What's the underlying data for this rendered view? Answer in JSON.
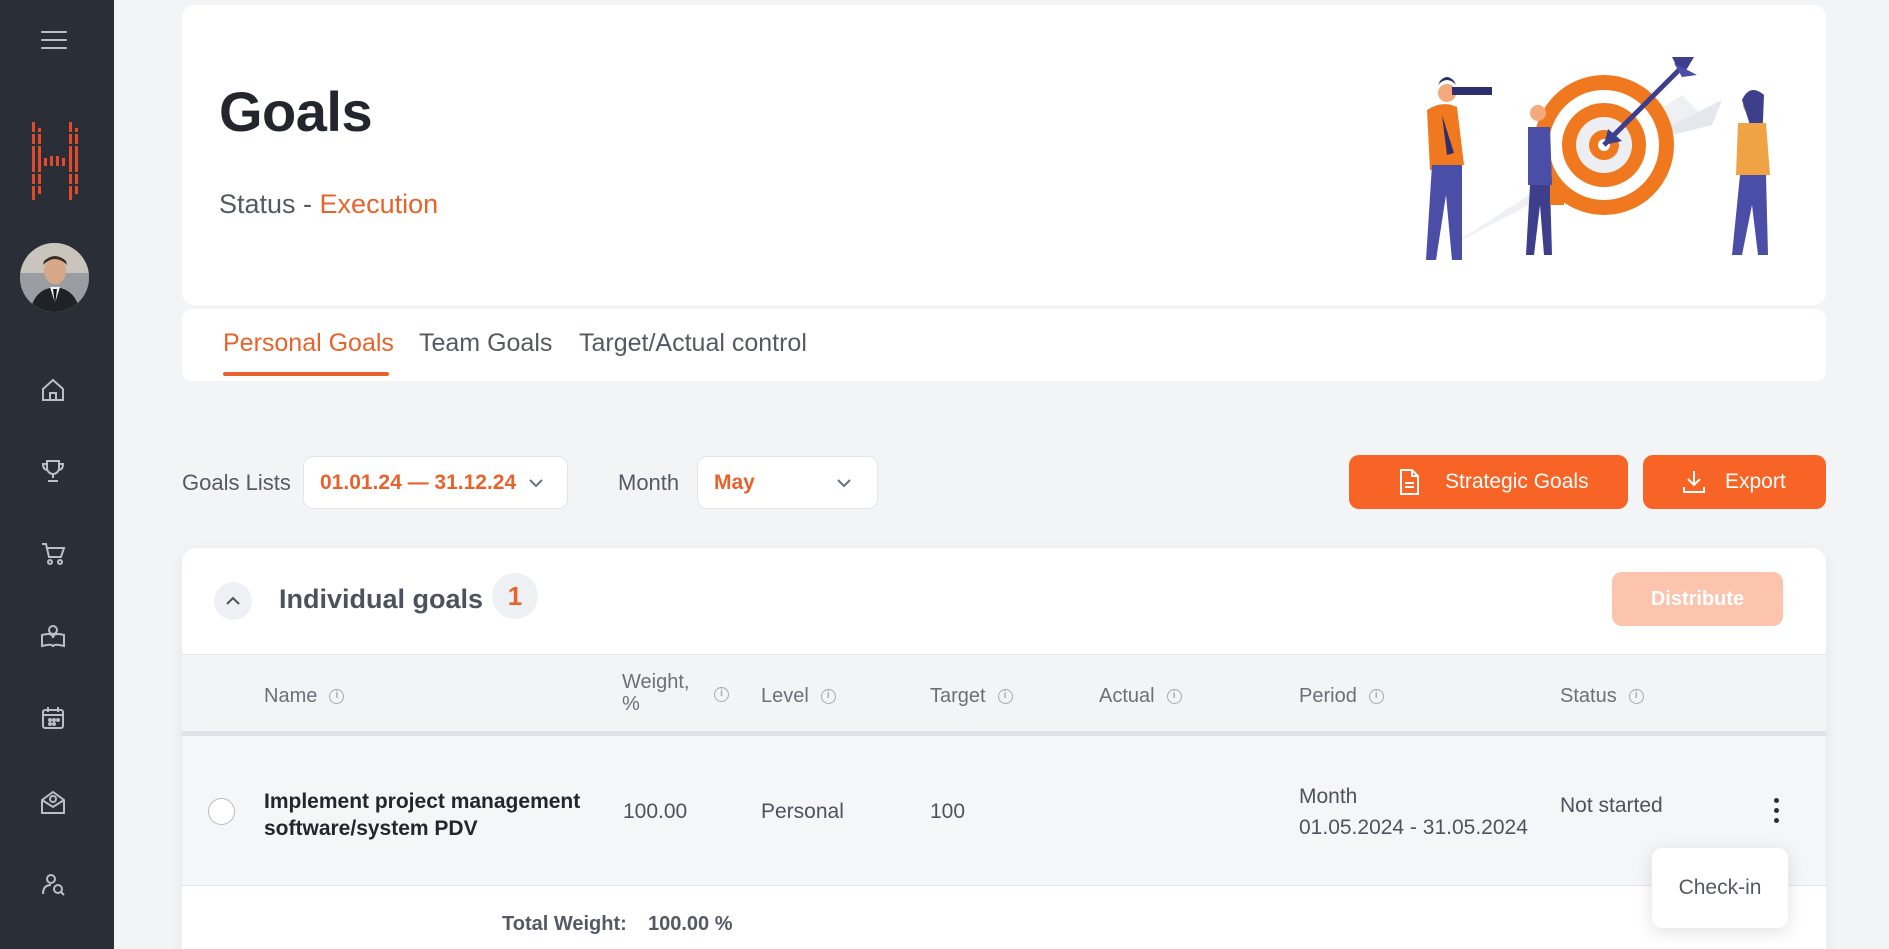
{
  "header": {
    "title": "Goals",
    "status_label": "Status - ",
    "status_value": "Execution"
  },
  "tabs": [
    {
      "label": "Personal Goals",
      "active": true
    },
    {
      "label": "Team Goals",
      "active": false
    },
    {
      "label": "Target/Actual control",
      "active": false
    }
  ],
  "filters": {
    "goals_lists_label": "Goals Lists",
    "goals_lists_value": "01.01.24 — 31.12.24",
    "month_label": "Month",
    "month_value": "May"
  },
  "actions": {
    "strategic_goals": "Strategic Goals",
    "export": "Export"
  },
  "panel": {
    "title": "Individual goals",
    "count": "1",
    "distribute": "Distribute"
  },
  "table": {
    "columns": {
      "name": "Name",
      "weight_line1": "Weight,",
      "weight_line2": "%",
      "level": "Level",
      "target": "Target",
      "actual": "Actual",
      "period": "Period",
      "status": "Status"
    },
    "rows": [
      {
        "name_line1": "Implement project management",
        "name_line2": "software/system PDV",
        "weight": "100.00",
        "level": "Personal",
        "target": "100",
        "actual": "",
        "period_type": "Month",
        "period_range": "01.05.2024 - 31.05.2024",
        "status": "Not started"
      }
    ],
    "total_label": "Total Weight:",
    "total_value": "100.00 %"
  },
  "popover": {
    "check_in": "Check-in"
  },
  "colors": {
    "accent": "#e8632b",
    "button": "#f86425",
    "sidebar": "#2a2f37",
    "distribute_disabled": "#fcc3ad"
  },
  "sidebar_icons": [
    "menu-icon",
    "home-icon",
    "trophy-icon",
    "cart-icon",
    "learning-icon",
    "calendar-icon",
    "mail-award-icon",
    "user-search-icon"
  ]
}
